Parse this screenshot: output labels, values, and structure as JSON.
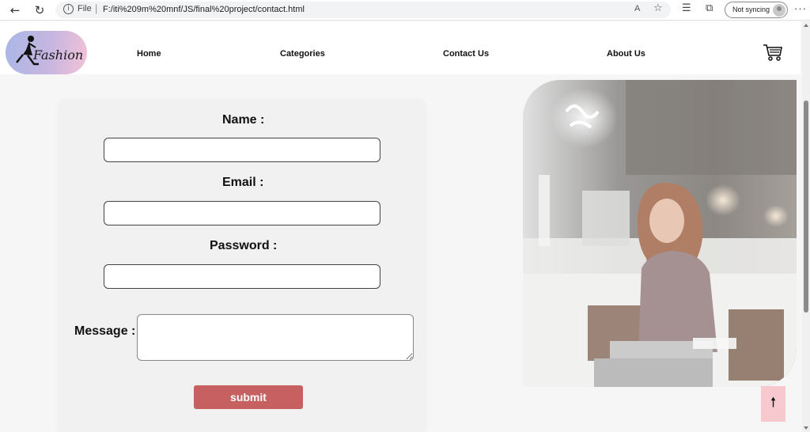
{
  "browser": {
    "back_glyph": "←",
    "refresh_glyph": "↻",
    "info_glyph": "i",
    "scheme_label": "File",
    "separator": "|",
    "url": "F:/iti%209m%20mnf/JS/final%20project/contact.html",
    "read_aloud_label": "A",
    "favorite_glyph": "☆",
    "favorites_glyph": "☰",
    "collections_glyph": "⧉",
    "sync_label": "Not syncing",
    "more_glyph": "···"
  },
  "site": {
    "logo_text": "Fashion",
    "nav": [
      {
        "label": "Home"
      },
      {
        "label": "Categories"
      },
      {
        "label": "Contact Us"
      },
      {
        "label": "About Us"
      }
    ]
  },
  "form": {
    "name_label": "Name :",
    "name_value": "",
    "email_label": "Email :",
    "email_value": "",
    "password_label": "Password :",
    "password_value": "",
    "message_label": "Message :",
    "message_value": "",
    "submit_label": "submit"
  },
  "scroll_top": {
    "glyph": "🠕"
  },
  "colors": {
    "accent_button": "#c76060",
    "scroll_top_bg": "#f7c9ce",
    "logo_gradient_start": "#a9b7e6",
    "logo_gradient_end": "#f4c2d7"
  }
}
